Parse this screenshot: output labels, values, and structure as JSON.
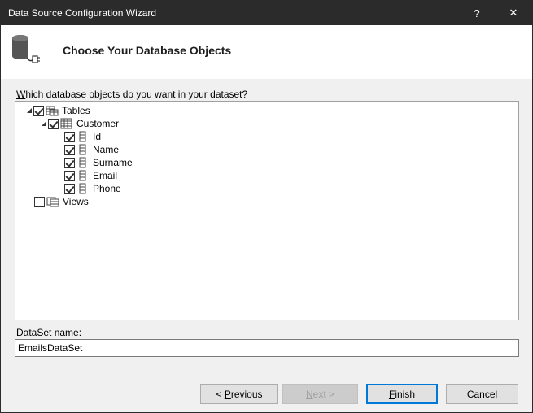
{
  "window": {
    "title": "Data Source Configuration Wizard",
    "help_glyph": "?",
    "close_glyph": "✕"
  },
  "header": {
    "heading": "Choose Your Database Objects",
    "icon": "database-plug-icon"
  },
  "prompt": {
    "accel": "W",
    "rest": "hich database objects do you want in your dataset?"
  },
  "tree": {
    "tables": {
      "label": "Tables",
      "checked": true,
      "expanded": true
    },
    "customer": {
      "label": "Customer",
      "checked": true,
      "expanded": true
    },
    "columns": [
      {
        "label": "Id",
        "checked": true
      },
      {
        "label": "Name",
        "checked": true
      },
      {
        "label": "Surname",
        "checked": true
      },
      {
        "label": "Email",
        "checked": true
      },
      {
        "label": "Phone",
        "checked": true
      }
    ],
    "views": {
      "label": "Views",
      "checked": false
    }
  },
  "dataset": {
    "label_accel": "D",
    "label_rest": "ataSet name:",
    "value": "EmailsDataSet"
  },
  "buttons": {
    "previous_prefix": "< ",
    "previous_accel": "P",
    "previous_rest": "revious",
    "next_accel": "N",
    "next_rest": "ext >",
    "finish_accel": "F",
    "finish_rest": "inish",
    "cancel": "Cancel"
  }
}
